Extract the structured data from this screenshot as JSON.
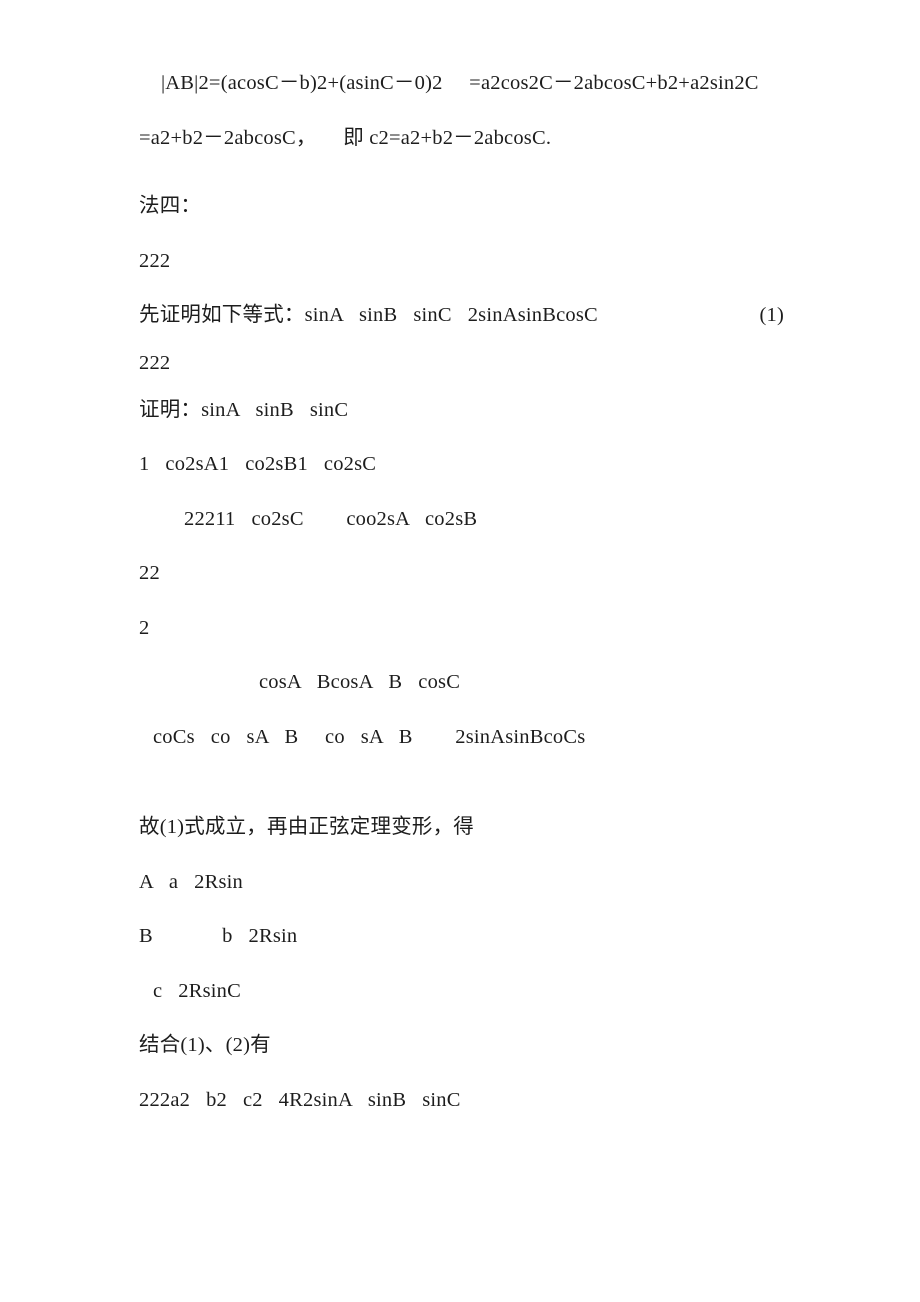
{
  "document": {
    "background_color": "#ffffff",
    "text_color": "#1d1d1d",
    "lines": {
      "l1": "|AB|2=(acosC－b)2+(asinC－0)2     =a2cos2C－2abcosC+b2+a2sin2C",
      "l2": "=a2+b2－2abcosC，     即 c2=a2+b2－2abcosC.",
      "l3": "法四：",
      "l4": "222",
      "l5": "先证明如下等式：sinA   sinB   sinC   2sinAsinBcosC",
      "l5_num": "(1)",
      "l6": "222",
      "l7": "证明：sinA   sinB   sinC",
      "l8": "1   co2sA1   co2sB1   co2sC",
      "l9": "22211   co2sC        coo2sA   co2sB",
      "l10": "22",
      "l11": "2",
      "l12": "cosA   BcosA   B   cosC",
      "l13": "coCs   co   sA   B     co   sA   B        2sinAsinBcoCs",
      "l14": "故(1)式成立，再由正弦定理变形，得",
      "l15": "A   a   2Rsin",
      "l16": "B             b   2Rsin",
      "l17": "c   2RsinC",
      "l18": "结合(1)、(2)有",
      "l19": "222a2   b2   c2   4R2sinA   sinB   sinC"
    }
  }
}
